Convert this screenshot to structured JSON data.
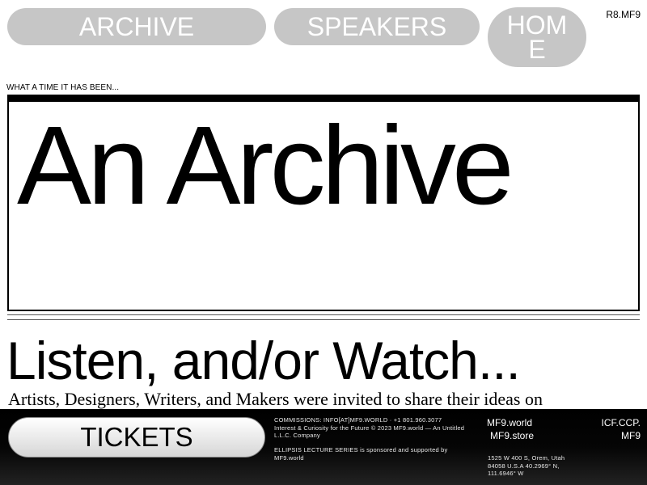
{
  "nav": {
    "archive": "ARCHIVE",
    "speakers": "SPEAKERS",
    "home": "HOME"
  },
  "corner_code": "R8.MF9",
  "hero": {
    "eyebrow": "WHAT A TIME IT HAS BEEN...",
    "title": "An Archive"
  },
  "section": {
    "title": "Listen, and/or Watch...",
    "intro": "Artists, Designers, Writers, and Makers were invited to share their ideas on"
  },
  "footer": {
    "tickets": "TICKETS",
    "commissions": "COMMISSIONS: INFO[AT]MF9.WORLD · +1 801.960.3077",
    "copyright": "Interest & Curiosity for the Future © 2023 MF9.world — An Untitled L.L.C. Company",
    "sponsor": "ELLIPSIS LECTURE SERIES is sponsored and supported by MF9.world",
    "link_world": "MF9.world",
    "link_store": "MF9.store",
    "address": "1525 W 400 S, Orem, Utah 84058 U.S.A 40.2969° N, 111.6946° W",
    "icf": "ICF.CCP. MF9"
  }
}
